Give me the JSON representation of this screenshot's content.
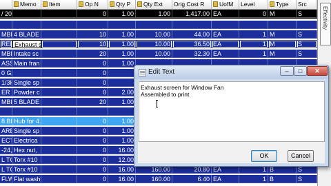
{
  "grid": {
    "header": {
      "col0": "",
      "memo": "Memo",
      "item": "Item",
      "op_no": "Op N",
      "qty_per": "Qty P",
      "qty_ext": "Qty Ext",
      "orig_cost": "Orig Cost R",
      "uofm": "UofM",
      "level": "Level",
      "type": "Type",
      "src": "Src"
    },
    "rows": [
      {
        "style": "dark",
        "c0": "/ 20\"",
        "memo": "",
        "item": "",
        "op": "0",
        "qtyp": "1.00",
        "qtye": "1.00",
        "cost": "1,417.00",
        "uofm": "EA",
        "level": "0",
        "type": "M",
        "src": "S"
      },
      {
        "style": "blank",
        "c0": "",
        "memo": "",
        "item": "",
        "op": "",
        "qtyp": "",
        "qtye": "",
        "cost": "",
        "uofm": "",
        "level": "",
        "type": "",
        "src": ""
      },
      {
        "style": "std",
        "c0": "MBL",
        "memo": "4 BLADE",
        "item": "",
        "op": "10",
        "qtyp": "1.00",
        "qtye": "10.00",
        "cost": "44.00",
        "uofm": "EA",
        "level": "1",
        "type": "M",
        "src": "S"
      },
      {
        "style": "sel",
        "c0": "REM",
        "memo": "Exhaust s",
        "item": "",
        "op": "10",
        "qtyp": "1.00",
        "qtye": "10.00",
        "cost": "36.50",
        "uofm": "EA",
        "level": "1",
        "type": "M",
        "src": "S"
      },
      {
        "style": "std",
        "c0": "MBL",
        "memo": "Intake sc",
        "item": "",
        "op": "20",
        "qtyp": "1.00",
        "qtye": "10.00",
        "cost": "32.30",
        "uofm": "EA",
        "level": "1",
        "type": "M",
        "src": "S"
      },
      {
        "style": "std",
        "c0": "ASS",
        "memo": "Main fran",
        "item": "",
        "op": "0",
        "qtyp": "1.00",
        "qtye": "",
        "cost": "",
        "uofm": "",
        "level": "",
        "type": "",
        "src": ""
      },
      {
        "style": "std",
        "c0": "0 GA",
        "memo": "",
        "item": "",
        "op": "0",
        "qtyp": "",
        "qtye": "",
        "cost": "",
        "uofm": "",
        "level": "",
        "type": "",
        "src": ""
      },
      {
        "style": "std",
        "c0": "1/3H",
        "memo": "Single sp",
        "item": "",
        "op": "0",
        "qtyp": "",
        "qtye": "",
        "cost": "",
        "uofm": "",
        "level": "",
        "type": "",
        "src": ""
      },
      {
        "style": "std",
        "c0": "ER C",
        "memo": "Powder c",
        "item": "",
        "op": "0",
        "qtyp": "2.00",
        "qtye": "",
        "cost": "",
        "uofm": "",
        "level": "",
        "type": "",
        "src": ""
      },
      {
        "style": "std",
        "c0": "MBL",
        "memo": "5 BLADE",
        "item": "",
        "op": "20",
        "qtyp": "1.00",
        "qtye": "",
        "cost": "",
        "uofm": "",
        "level": "",
        "type": "",
        "src": ""
      },
      {
        "style": "blank",
        "c0": "",
        "memo": "",
        "item": "",
        "op": "",
        "qtyp": "",
        "qtye": "",
        "cost": "",
        "uofm": "",
        "level": "",
        "type": "",
        "src": ""
      },
      {
        "style": "light",
        "c0": "8 BL",
        "memo": "Hub for 4",
        "item": "",
        "op": "0",
        "qtyp": "1.00",
        "qtye": "",
        "cost": "",
        "uofm": "",
        "level": "",
        "type": "",
        "src": ""
      },
      {
        "style": "std",
        "c0": "ARE",
        "memo": "Single sp",
        "item": "",
        "op": "0",
        "qtyp": "1.00",
        "qtye": "",
        "cost": "",
        "uofm": "",
        "level": "",
        "type": "",
        "src": ""
      },
      {
        "style": "std",
        "c0": "ECT",
        "memo": "Electrica",
        "item": "",
        "op": "0",
        "qtyp": "1.00",
        "qtye": "",
        "cost": "",
        "uofm": "",
        "level": "",
        "type": "",
        "src": ""
      },
      {
        "style": "std",
        "c0": "-24,",
        "memo": "Hex nut,",
        "item": "",
        "op": "0",
        "qtyp": "16.00",
        "qtye": "",
        "cost": "",
        "uofm": "",
        "level": "",
        "type": "",
        "src": ""
      },
      {
        "style": "std",
        "c0": "L TC",
        "memo": "Torx #10",
        "item": "",
        "op": "0",
        "qtyp": "12.00",
        "qtye": "",
        "cost": "",
        "uofm": "",
        "level": "",
        "type": "",
        "src": ""
      },
      {
        "style": "std",
        "c0": "L TC",
        "memo": "Torx #10",
        "item": "",
        "op": "0",
        "qtyp": "16.00",
        "qtye": "160.00",
        "cost": "20.80",
        "uofm": "EA",
        "level": "1",
        "type": "B",
        "src": "S"
      },
      {
        "style": "std",
        "c0": "FLW",
        "memo": "Flat wash",
        "item": "",
        "op": "0",
        "qtyp": "16.00",
        "qtye": "160.00",
        "cost": "6.40",
        "uofm": "EA",
        "level": "1",
        "type": "B",
        "src": "S"
      }
    ]
  },
  "side_panel": {
    "label": "Effectivity"
  },
  "dialog": {
    "title": "Edit Text",
    "text_line1": "Exhaust screen for Window Fan",
    "text_line2": "Assembled to print",
    "ok_label": "OK",
    "cancel_label": "Cancel",
    "min_glyph": "–",
    "max_glyph": "□",
    "close_glyph": "✕"
  }
}
